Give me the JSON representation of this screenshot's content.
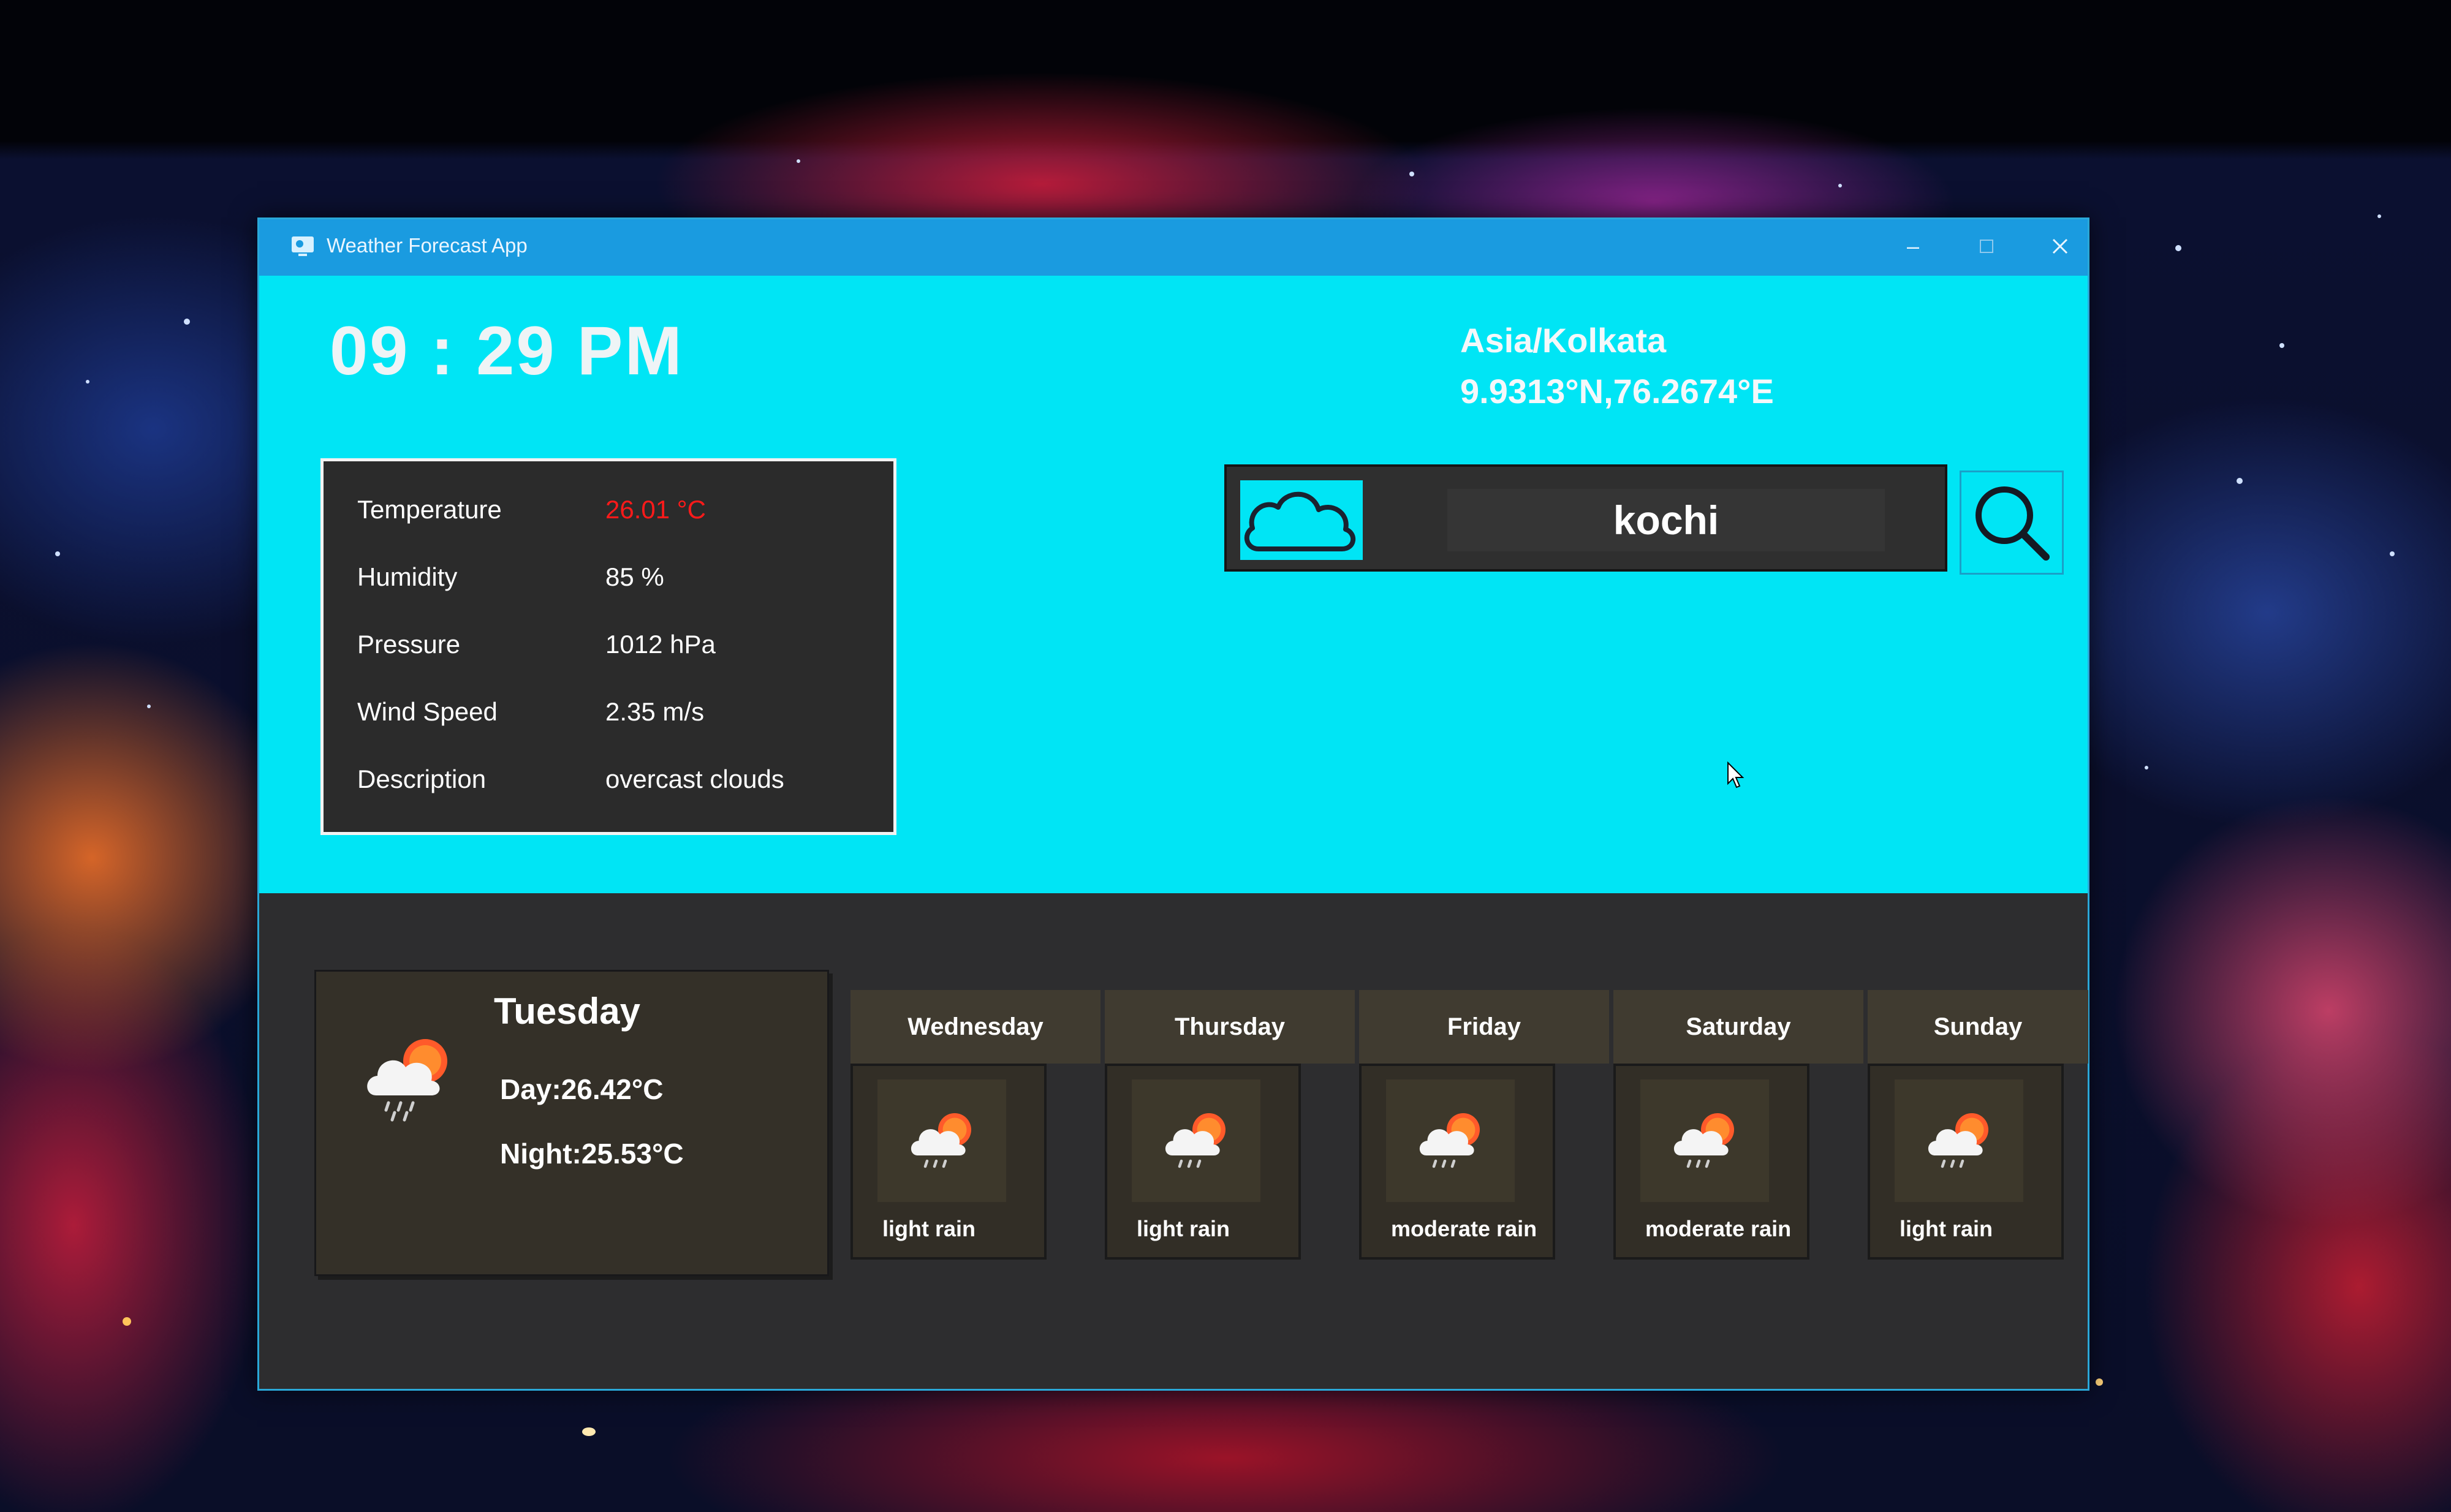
{
  "window": {
    "title": "Weather Forecast App"
  },
  "header": {
    "time": "09 : 29 PM",
    "timezone": "Asia/Kolkata",
    "coordinates": "9.9313°N,76.2674°E"
  },
  "current": {
    "rows": [
      {
        "label": "Temperature",
        "value": "26.01 °C"
      },
      {
        "label": "Humidity",
        "value": "85 %"
      },
      {
        "label": "Pressure",
        "value": "1012 hPa"
      },
      {
        "label": "Wind Speed",
        "value": "2.35 m/s"
      },
      {
        "label": "Description",
        "value": "overcast clouds"
      }
    ],
    "temperature_color": "#ff1a1a"
  },
  "search": {
    "value": "kochi",
    "logo_icon": "cloud-outline-icon",
    "button_icon": "magnifier-icon"
  },
  "today": {
    "day": "Tuesday",
    "day_temp": "Day:26.42°C",
    "night_temp": "Night:25.53°C",
    "icon": "rain-cloud-sun-icon"
  },
  "forecast": [
    {
      "day": "Wednesday",
      "description": "light rain",
      "icon": "rain-cloud-sun-icon"
    },
    {
      "day": "Thursday",
      "description": "light rain",
      "icon": "rain-cloud-sun-icon"
    },
    {
      "day": "Friday",
      "description": "moderate rain",
      "icon": "rain-cloud-sun-icon"
    },
    {
      "day": "Saturday",
      "description": "moderate rain",
      "icon": "rain-cloud-sun-icon"
    },
    {
      "day": "Sunday",
      "description": "light rain",
      "icon": "rain-cloud-sun-icon"
    }
  ],
  "colors": {
    "window_bg": "#00e5f5",
    "titlebar": "#1a9be0",
    "bottom_panel": "#2d2d2f"
  }
}
